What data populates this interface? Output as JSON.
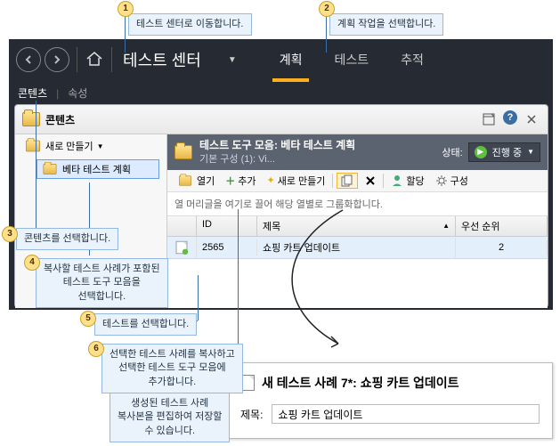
{
  "callouts": {
    "c1": "테스트 센터로 이동합니다.",
    "c2": "계획 작업을 선택합니다.",
    "c3": "콘텐츠를 선택합니다.",
    "c4": "복사할 테스트 사례가 포함된\n테스트 도구 모음을\n선택합니다.",
    "c5": "테스트를 선택합니다.",
    "c6": "선택한 테스트 사례를 복사하고\n선택한 테스트 도구 모음에\n추가합니다.",
    "c6b": "생성된 테스트 사례\n복사본을 편집하여 저장할\n수 있습니다."
  },
  "nav": {
    "title": "테스트 센터",
    "tabs": {
      "plan": "계획",
      "test": "테스트",
      "track": "추적"
    }
  },
  "subtabs": {
    "contents": "콘텐츠",
    "properties": "속성"
  },
  "panel": {
    "title": "콘텐츠",
    "new_button": "새로 만들기",
    "tree_item": "베타 테스트 계획"
  },
  "detail": {
    "header_title": "테스트 도구 모음: 베타 테스트 계획",
    "header_sub": "기본 구성 (1): Vi...",
    "state_label": "상태:",
    "state_value": "진행 중",
    "toolbar": {
      "open": "열기",
      "add": "추가",
      "new": "새로 만들기",
      "assign": "할당",
      "configure": "구성"
    },
    "group_hint": "열 머리글을 여기로 끌어 해당 열별로 그룹화합니다.",
    "columns": {
      "id": "ID",
      "title": "제목",
      "priority": "우선 순위"
    },
    "row": {
      "id": "2565",
      "title": "쇼핑 카트 업데이트",
      "priority": "2"
    }
  },
  "newcase": {
    "title": "새 테스트 사례 7*: 쇼핑 카트 업데이트",
    "field_label": "제목:",
    "field_value": "쇼핑 카트 업데이트"
  }
}
